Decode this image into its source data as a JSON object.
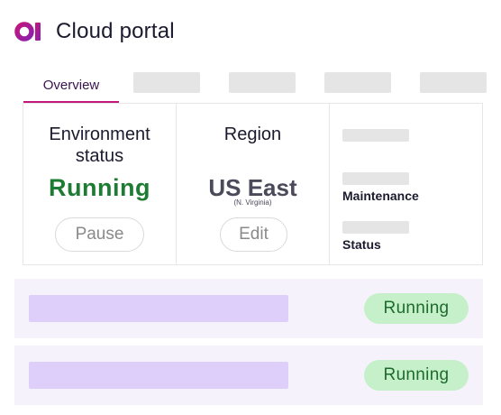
{
  "header": {
    "logo_icon": "cloud-portal-logo-icon",
    "title": "Cloud portal"
  },
  "tabs": {
    "active": {
      "label": "Overview"
    },
    "placeholder_count": 4
  },
  "environment": {
    "heading_line1": "Environment",
    "heading_line2": "status",
    "status": "Running",
    "action_label": "Pause"
  },
  "region": {
    "heading": "Region",
    "value": "US East",
    "subvalue": "(N. Virginia)",
    "action_label": "Edit"
  },
  "meta": {
    "maintenance_label": "Maintenance",
    "status_label": "Status"
  },
  "rows": [
    {
      "status": "Running"
    },
    {
      "status": "Running"
    }
  ],
  "colors": {
    "brand_accent": "#c2187a",
    "running_text": "#1e7b34",
    "badge_bg": "#c6f0c9",
    "row_bg": "#f6f2fc",
    "row_placeholder": "#ddcffa",
    "placeholder_gray": "#e5e5e5"
  }
}
